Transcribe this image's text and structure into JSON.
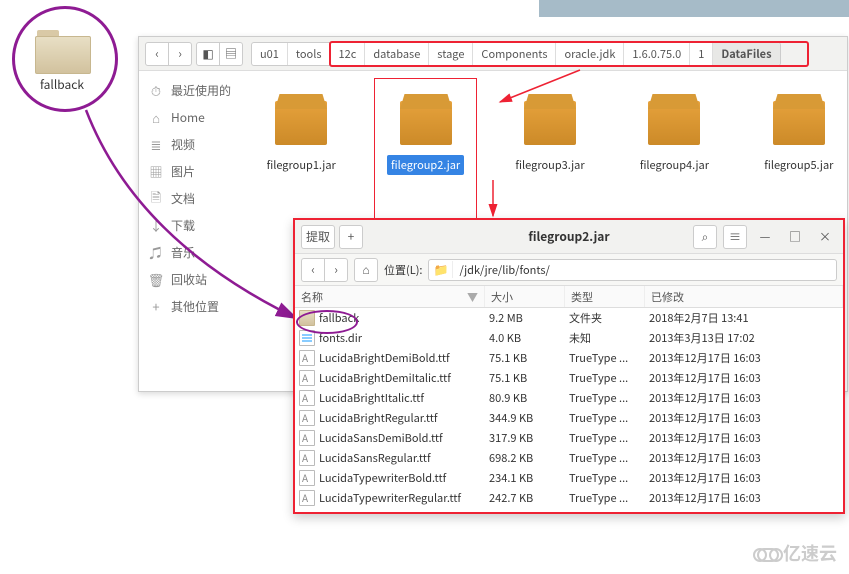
{
  "desktop": {
    "folder_name": "fallback"
  },
  "win1": {
    "back_icon": "‹",
    "fwd_icon": "›",
    "browse_icon": "◧",
    "disk_icon": "▤",
    "crumbs": [
      "u01",
      "tools",
      "12c",
      "database",
      "stage",
      "Components",
      "oracle.jdk",
      "1.6.0.75.0",
      "1",
      "DataFiles"
    ],
    "sidebar": [
      {
        "icon": "⏱",
        "label": "最近使用的"
      },
      {
        "icon": "⌂",
        "label": "Home"
      },
      {
        "icon": "≣",
        "label": "视频"
      },
      {
        "icon": "▦",
        "label": "图片"
      },
      {
        "icon": "🗎",
        "label": "文档"
      },
      {
        "icon": "↓",
        "label": "下载"
      },
      {
        "icon": "♫",
        "label": "音乐"
      },
      {
        "icon": "🗑",
        "label": "回收站"
      },
      {
        "icon": "+",
        "label": "其他位置"
      }
    ],
    "items": [
      {
        "name": "filegroup1.jar",
        "sel": false
      },
      {
        "name": "filegroup2.jar",
        "sel": true
      },
      {
        "name": "filegroup3.jar",
        "sel": false
      },
      {
        "name": "filegroup4.jar",
        "sel": false
      },
      {
        "name": "filegroup5.jar",
        "sel": false
      }
    ]
  },
  "win2": {
    "extract_label": "提取",
    "plus_label": "+",
    "title": "filegroup2.jar",
    "search_icon": "⌕",
    "menu_icon": "≡",
    "min_icon": "—",
    "max_icon": "□",
    "close_icon": "×",
    "back_icon": "‹",
    "fwd_icon": "›",
    "home_icon": "⌂",
    "loc_label": "位置(L):",
    "folder_icon": "📁",
    "path": "/jdk/jre/lib/fonts/",
    "headers": {
      "name": "名称",
      "size": "大小",
      "type": "类型",
      "mod": "已修改",
      "sort": "▼"
    },
    "rows": [
      {
        "ico": "folder",
        "name": "fallback",
        "size": "9.2 MB",
        "type": "文件夹",
        "mod": "2018年2月7日 13:41"
      },
      {
        "ico": "text",
        "name": "fonts.dir",
        "size": "4.0 KB",
        "type": "未知",
        "mod": "2013年3月13日 17:02"
      },
      {
        "ico": "font",
        "name": "LucidaBrightDemiBold.ttf",
        "size": "75.1 KB",
        "type": "TrueType ...",
        "mod": "2013年12月17日 16:03"
      },
      {
        "ico": "font",
        "name": "LucidaBrightDemiItalic.ttf",
        "size": "75.1 KB",
        "type": "TrueType ...",
        "mod": "2013年12月17日 16:03"
      },
      {
        "ico": "font",
        "name": "LucidaBrightItalic.ttf",
        "size": "80.9 KB",
        "type": "TrueType ...",
        "mod": "2013年12月17日 16:03"
      },
      {
        "ico": "font",
        "name": "LucidaBrightRegular.ttf",
        "size": "344.9 KB",
        "type": "TrueType ...",
        "mod": "2013年12月17日 16:03"
      },
      {
        "ico": "font",
        "name": "LucidaSansDemiBold.ttf",
        "size": "317.9 KB",
        "type": "TrueType ...",
        "mod": "2013年12月17日 16:03"
      },
      {
        "ico": "font",
        "name": "LucidaSansRegular.ttf",
        "size": "698.2 KB",
        "type": "TrueType ...",
        "mod": "2013年12月17日 16:03"
      },
      {
        "ico": "font",
        "name": "LucidaTypewriterBold.ttf",
        "size": "234.1 KB",
        "type": "TrueType ...",
        "mod": "2013年12月17日 16:03"
      },
      {
        "ico": "font",
        "name": "LucidaTypewriterRegular.ttf",
        "size": "242.7 KB",
        "type": "TrueType ...",
        "mod": "2013年12月17日 16:03"
      }
    ]
  },
  "watermark": "亿速云"
}
